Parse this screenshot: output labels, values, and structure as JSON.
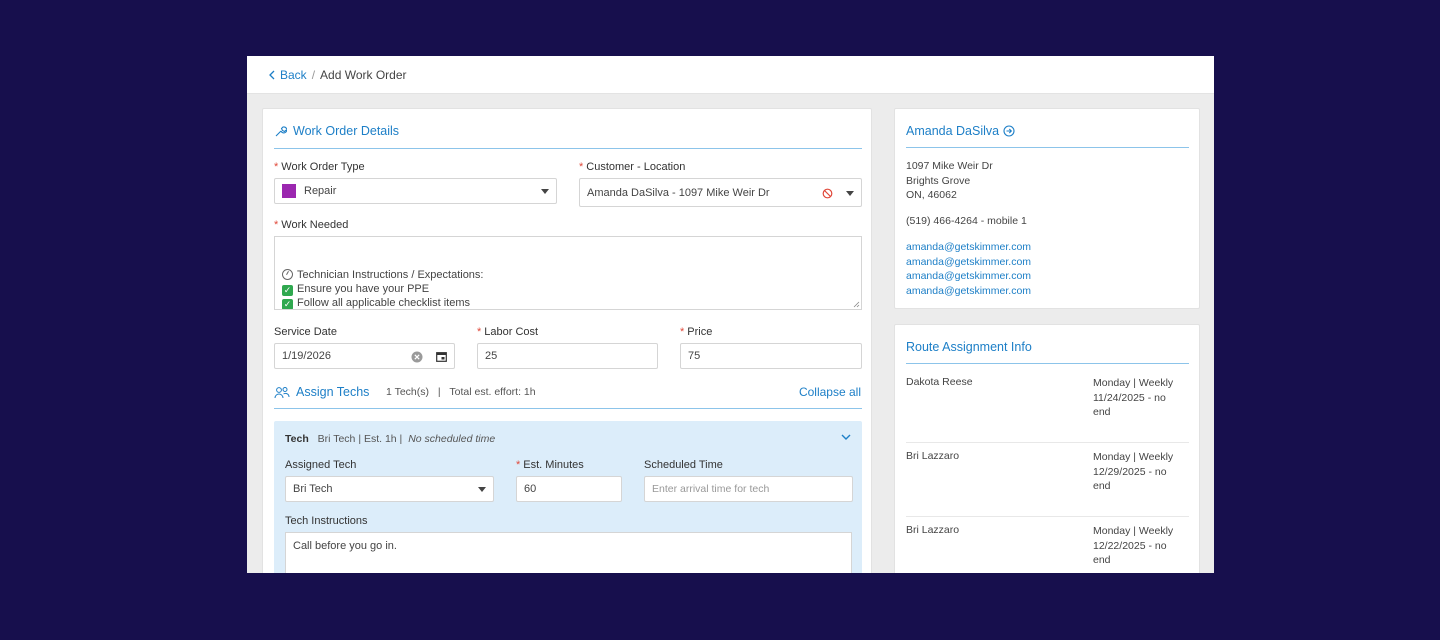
{
  "breadcrumb": {
    "back": "Back",
    "separator": "/",
    "current": "Add Work Order"
  },
  "details": {
    "title": "Work Order Details",
    "work_order_type": {
      "label": "Work Order Type",
      "value": "Repair",
      "swatch": "#9b27af"
    },
    "customer_location": {
      "label": "Customer - Location",
      "value": "Amanda DaSilva - 1097 Mike Weir Dr"
    },
    "work_needed": {
      "label": "Work Needed",
      "lines": [
        "Technician Instructions / Expectations:",
        "Ensure you have your PPE",
        "Follow all applicable checklist items"
      ]
    },
    "service_date": {
      "label": "Service Date",
      "value": "1/19/2026"
    },
    "labor_cost": {
      "label": "Labor Cost",
      "value": "25"
    },
    "price": {
      "label": "Price",
      "value": "75"
    }
  },
  "assign": {
    "title": "Assign Techs",
    "techs_count": "1 Tech(s)",
    "divider": "|",
    "total_effort": "Total est. effort: 1h",
    "collapse": "Collapse all",
    "tech": {
      "header": "Tech",
      "summary": "Bri Tech | Est. 1h |",
      "schedule_note": "No scheduled time",
      "assigned_label": "Assigned Tech",
      "assigned_value": "Bri Tech",
      "minutes_label": "Est. Minutes",
      "minutes_value": "60",
      "time_label": "Scheduled Time",
      "time_placeholder": "Enter arrival time for tech",
      "instructions_label": "Tech Instructions",
      "instructions_value": "Call before you go in."
    }
  },
  "customer": {
    "name": "Amanda DaSilva",
    "address": [
      "1097 Mike Weir Dr",
      "Brights Grove",
      "ON, 46062"
    ],
    "phone": "(519) 466-4264 - mobile 1",
    "emails": [
      "amanda@getskimmer.com",
      "amanda@getskimmer.com",
      "amanda@getskimmer.com",
      "amanda@getskimmer.com"
    ]
  },
  "routes": {
    "title": "Route Assignment Info",
    "rows": [
      {
        "name": "Dakota Reese",
        "day": "Monday | Weekly",
        "date": "11/24/2025 - no",
        "end": "end"
      },
      {
        "name": "Bri Lazzaro",
        "day": "Monday | Weekly",
        "date": "12/29/2025 - no",
        "end": "end"
      },
      {
        "name": "Bri Lazzaro",
        "day": "Monday | Weekly",
        "date": "12/22/2025 - no",
        "end": "end"
      }
    ]
  },
  "colors": {
    "accent": "#1d7fc7",
    "background": "#170f4d",
    "required": "#e0483a",
    "tech_panel": "#dcedfa"
  }
}
